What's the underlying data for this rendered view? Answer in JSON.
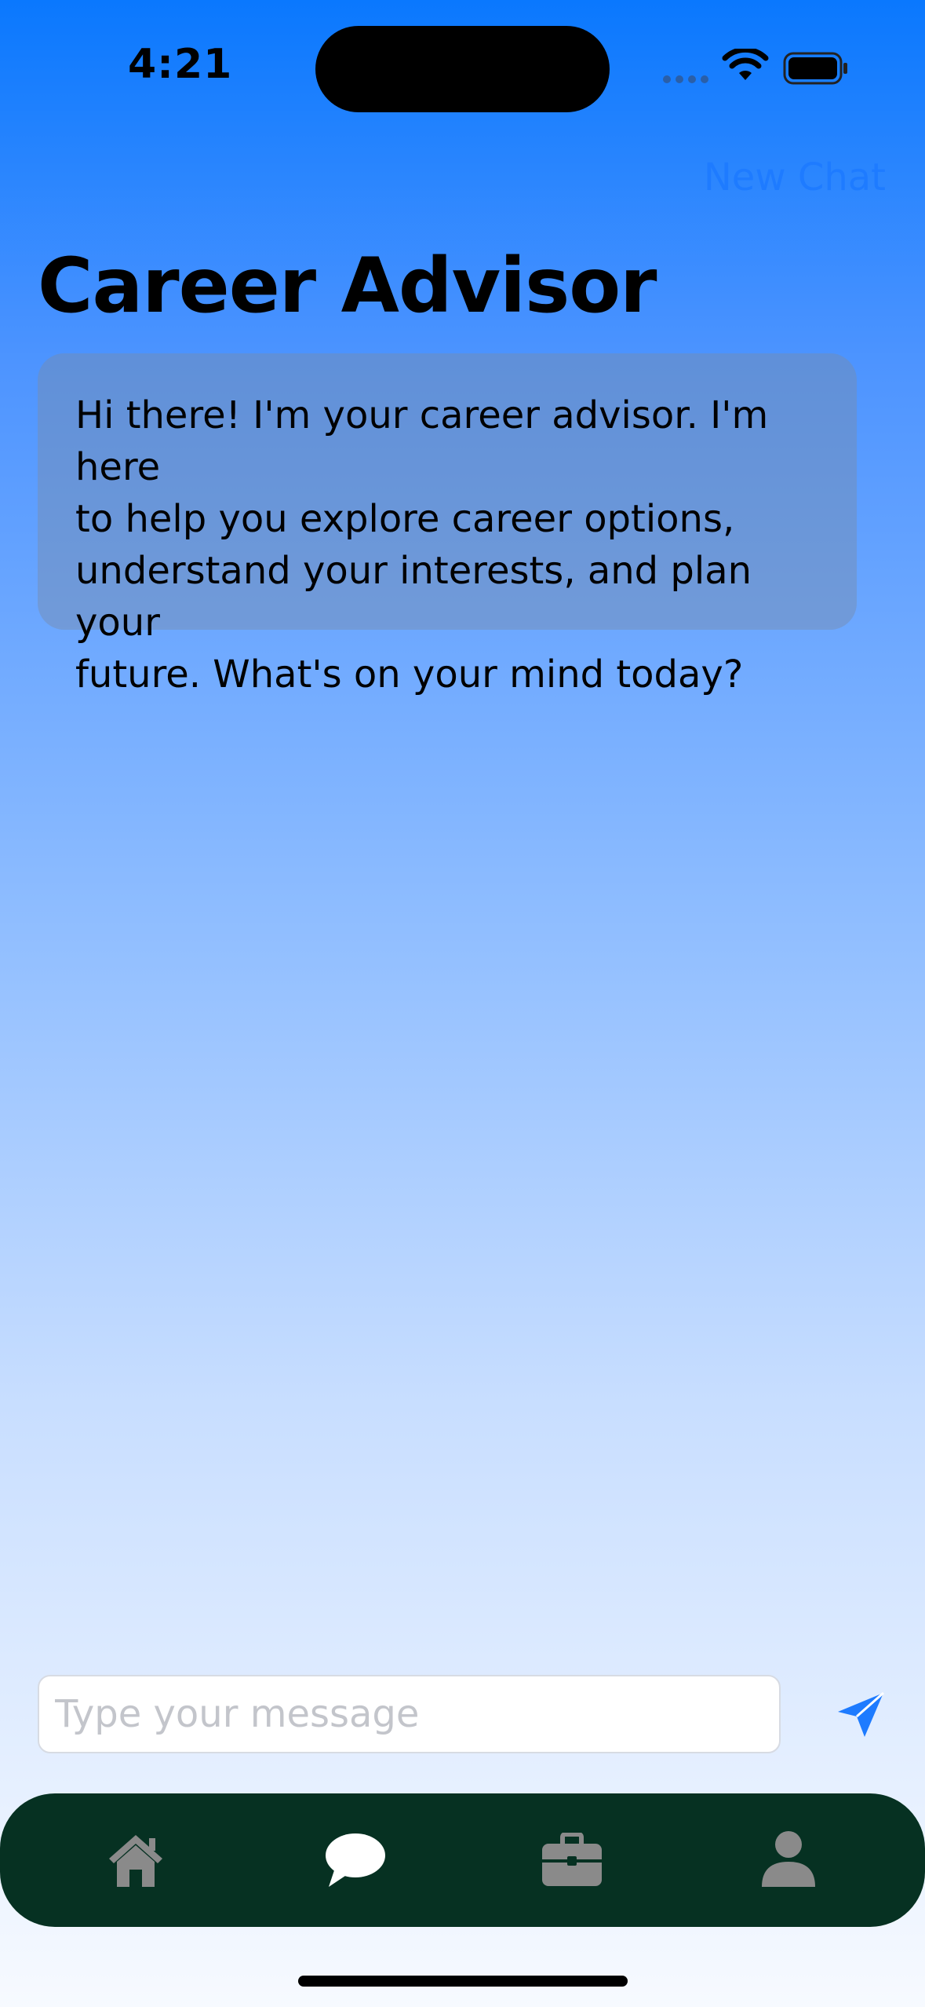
{
  "status_bar": {
    "time": "4:21"
  },
  "header": {
    "new_chat_label": "New Chat",
    "title": "Career Advisor"
  },
  "chat": {
    "messages": [
      {
        "role": "assistant",
        "lines": [
          "Hi there! I'm your career advisor. I'm here",
          "to help you explore career options,",
          "understand your interests, and plan your",
          "future. What's on your mind today?"
        ]
      }
    ]
  },
  "composer": {
    "placeholder": "Type your message",
    "value": "",
    "send_icon": "paper-plane-icon"
  },
  "tab_bar": {
    "tabs": [
      {
        "icon": "home-icon",
        "active": false
      },
      {
        "icon": "chat-bubble-icon",
        "active": true
      },
      {
        "icon": "briefcase-icon",
        "active": false
      },
      {
        "icon": "person-icon",
        "active": false
      }
    ]
  },
  "colors": {
    "accent": "#1e7bff",
    "tab_bar_bg": "#063122",
    "tab_icon_inactive": "#8a8a8a",
    "tab_icon_active": "#ffffff"
  }
}
